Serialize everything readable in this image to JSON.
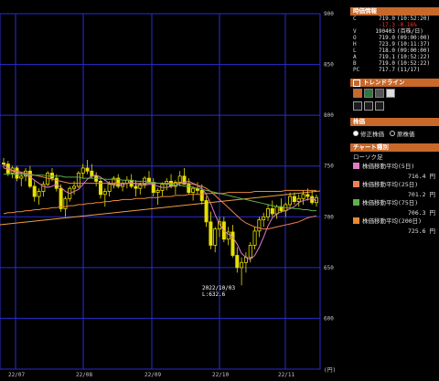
{
  "chart_data": {
    "type": "candlestick",
    "y_ticks": [
      "900",
      "850",
      "800",
      "750",
      "700",
      "650",
      "600"
    ],
    "y_unit": "(円)",
    "ylim": [
      550,
      900
    ],
    "x_ticks": [
      "22/07",
      "22/08",
      "22/09",
      "22/10",
      "22/11"
    ],
    "annotation": {
      "date": "2022/10/03",
      "low": "L:632.6"
    },
    "candles": [
      [
        753,
        758,
        748,
        752
      ],
      [
        752,
        755,
        740,
        743
      ],
      [
        743,
        750,
        738,
        748
      ],
      [
        748,
        750,
        735,
        738
      ],
      [
        738,
        742,
        730,
        740
      ],
      [
        740,
        748,
        735,
        745
      ],
      [
        745,
        750,
        728,
        730
      ],
      [
        730,
        735,
        715,
        720
      ],
      [
        720,
        728,
        712,
        725
      ],
      [
        725,
        735,
        720,
        732
      ],
      [
        732,
        745,
        730,
        743
      ],
      [
        743,
        748,
        735,
        738
      ],
      [
        738,
        742,
        725,
        728
      ],
      [
        728,
        732,
        705,
        708
      ],
      [
        708,
        720,
        700,
        718
      ],
      [
        718,
        730,
        715,
        728
      ],
      [
        728,
        735,
        722,
        730
      ],
      [
        730,
        745,
        728,
        743
      ],
      [
        743,
        752,
        738,
        748
      ],
      [
        748,
        756,
        742,
        745
      ],
      [
        745,
        752,
        738,
        740
      ],
      [
        740,
        744,
        730,
        735
      ],
      [
        735,
        738,
        718,
        722
      ],
      [
        722,
        728,
        710,
        725
      ],
      [
        725,
        735,
        720,
        732
      ],
      [
        732,
        740,
        728,
        738
      ],
      [
        738,
        742,
        728,
        730
      ],
      [
        730,
        735,
        725,
        733
      ],
      [
        733,
        740,
        728,
        736
      ],
      [
        736,
        742,
        728,
        730
      ],
      [
        730,
        736,
        720,
        728
      ],
      [
        728,
        734,
        722,
        732
      ],
      [
        732,
        740,
        728,
        738
      ],
      [
        738,
        745,
        732,
        734
      ],
      [
        734,
        738,
        720,
        724
      ],
      [
        724,
        728,
        712,
        726
      ],
      [
        726,
        734,
        720,
        732
      ],
      [
        732,
        738,
        726,
        735
      ],
      [
        735,
        742,
        728,
        730
      ],
      [
        730,
        736,
        722,
        734
      ],
      [
        734,
        745,
        730,
        740
      ],
      [
        740,
        748,
        736,
        732
      ],
      [
        732,
        738,
        722,
        724
      ],
      [
        724,
        730,
        716,
        728
      ],
      [
        728,
        734,
        722,
        726
      ],
      [
        726,
        732,
        712,
        716
      ],
      [
        716,
        720,
        690,
        695
      ],
      [
        695,
        705,
        668,
        672
      ],
      [
        672,
        690,
        665,
        688
      ],
      [
        688,
        700,
        680,
        695
      ],
      [
        695,
        700,
        675,
        678
      ],
      [
        678,
        690,
        672,
        685
      ],
      [
        685,
        692,
        660,
        662
      ],
      [
        662,
        670,
        645,
        650
      ],
      [
        650,
        660,
        632.6,
        655
      ],
      [
        655,
        665,
        645,
        660
      ],
      [
        660,
        675,
        655,
        672
      ],
      [
        672,
        690,
        668,
        686
      ],
      [
        686,
        700,
        680,
        697
      ],
      [
        697,
        704,
        690,
        700
      ],
      [
        700,
        712,
        696,
        708
      ],
      [
        708,
        716,
        700,
        703
      ],
      [
        703,
        712,
        698,
        710
      ],
      [
        710,
        718,
        704,
        706
      ],
      [
        706,
        714,
        700,
        712
      ],
      [
        712,
        724,
        708,
        720
      ],
      [
        720,
        724,
        712,
        715
      ],
      [
        715,
        722,
        710,
        718
      ],
      [
        718,
        726,
        712,
        722
      ],
      [
        722,
        728,
        716,
        720
      ],
      [
        720,
        726,
        712,
        714
      ],
      [
        714,
        722,
        710,
        719
      ]
    ],
    "series": [
      {
        "name": "株価移動平均(5日)",
        "value": "716.4 円",
        "color": "#e07ac8",
        "values": [
          752,
          748,
          745,
          744,
          743,
          741,
          739,
          736,
          733,
          730,
          729,
          730,
          732,
          729,
          725,
          723,
          725,
          727,
          732,
          737,
          740,
          741,
          739,
          736,
          733,
          731,
          731,
          732,
          733,
          734,
          732,
          731,
          731,
          732,
          732,
          730,
          729,
          729,
          730,
          731,
          733,
          734,
          735,
          733,
          731,
          728,
          722,
          713,
          702,
          693,
          686,
          683,
          680,
          673,
          664,
          660,
          658,
          662,
          670,
          680,
          691,
          699,
          703,
          705,
          706,
          708,
          710,
          714,
          716,
          717,
          718,
          716
        ]
      },
      {
        "name": "株価移動平均(25日)",
        "value": "701.2 円",
        "color": "#f08050",
        "values": [
          748,
          747,
          746,
          745,
          744,
          743,
          742,
          741,
          740,
          739,
          738,
          737,
          736,
          735,
          734,
          733,
          733,
          733,
          733,
          733,
          733,
          733,
          733,
          733,
          733,
          733,
          733,
          733,
          733,
          733,
          733,
          733,
          733,
          733,
          733,
          733,
          733,
          733,
          733,
          733,
          733,
          733,
          733,
          732,
          731,
          730,
          728,
          725,
          721,
          717,
          713,
          709,
          705,
          701,
          697,
          694,
          692,
          690,
          689,
          688,
          688,
          689,
          690,
          691,
          692,
          693,
          694,
          695,
          697,
          699,
          700,
          701
        ]
      },
      {
        "name": "株価移動平均(75日)",
        "value": "706.3 円",
        "color": "#5fb04a",
        "values": [
          742,
          742,
          742,
          742,
          742,
          742,
          741,
          741,
          741,
          741,
          740,
          740,
          740,
          740,
          739,
          739,
          739,
          739,
          738,
          738,
          738,
          738,
          738,
          737,
          737,
          737,
          737,
          736,
          736,
          736,
          735,
          735,
          735,
          734,
          734,
          733,
          733,
          732,
          732,
          731,
          731,
          730,
          730,
          729,
          728,
          727,
          726,
          725,
          724,
          723,
          722,
          721,
          720,
          719,
          718,
          717,
          716,
          715,
          714,
          713,
          712,
          711,
          710,
          710,
          709,
          709,
          708,
          708,
          707,
          707,
          706,
          706
        ]
      },
      {
        "name": "株価移動平均(200日)",
        "value": "725.6 円",
        "color": "#e88a38",
        "values": [
          703,
          704,
          704,
          705,
          705,
          706,
          706,
          707,
          707,
          708,
          708,
          709,
          709,
          710,
          710,
          711,
          711,
          712,
          712,
          713,
          713,
          714,
          714,
          715,
          715,
          716,
          716,
          717,
          717,
          717,
          718,
          718,
          718,
          719,
          719,
          719,
          720,
          720,
          720,
          721,
          721,
          721,
          722,
          722,
          722,
          722,
          723,
          723,
          723,
          723,
          723,
          724,
          724,
          724,
          724,
          724,
          724,
          725,
          725,
          725,
          725,
          725,
          725,
          725,
          726,
          726,
          726,
          726,
          726,
          726,
          726,
          726
        ]
      }
    ]
  },
  "panel": {
    "quote_title": "時価情報",
    "quote_rows": [
      {
        "k": "C",
        "v": "719.0",
        "t": "(10:52:20)",
        "red": false
      },
      {
        "k": "",
        "v": "-17.3",
        "t": "-0.16%",
        "red": true
      },
      {
        "k": "V",
        "v": "190403",
        "t": "(百株/日)",
        "red": false
      },
      {
        "k": "O",
        "v": "719.0",
        "t": "(09:00:00)",
        "red": false
      },
      {
        "k": "H",
        "v": "723.9",
        "t": "(10:11:37)",
        "red": false
      },
      {
        "k": "L",
        "v": "718.0",
        "t": "(09:00:00)",
        "red": false
      },
      {
        "k": "A",
        "v": "719.1",
        "t": "(10:52:22)",
        "red": false
      },
      {
        "k": "B",
        "v": "719.0",
        "t": "(10:52:22)",
        "red": false
      },
      {
        "k": "PC",
        "v": "717.7",
        "t": "(11/17)",
        "red": false
      }
    ],
    "trend_title": "トレンドライン",
    "price_title": "株価",
    "radio_adjusted": "修正株価",
    "radio_original": "原株価",
    "chart_type_title": "チャート種別",
    "candle_label": "ローソク足"
  }
}
